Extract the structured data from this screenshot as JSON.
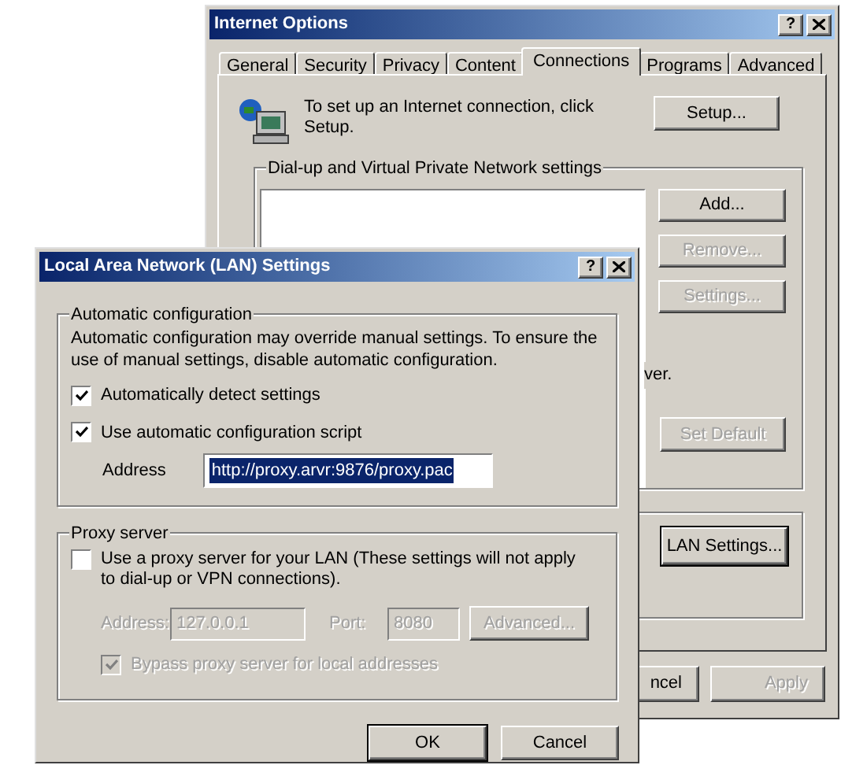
{
  "internet_options": {
    "title": "Internet Options",
    "help": "?",
    "tabs": [
      {
        "label": "General",
        "selected": false
      },
      {
        "label": "Security",
        "selected": false
      },
      {
        "label": "Privacy",
        "selected": false
      },
      {
        "label": "Content",
        "selected": false
      },
      {
        "label": "Connections",
        "selected": true
      },
      {
        "label": "Programs",
        "selected": false
      },
      {
        "label": "Advanced",
        "selected": false
      }
    ],
    "setup_text": "To set up an Internet connection, click Setup.",
    "setup_button": "Setup...",
    "dialup_group": "Dial-up and Virtual Private Network settings",
    "dialup_buttons": [
      {
        "label": "Add...",
        "disabled": false
      },
      {
        "label": "Remove...",
        "disabled": true
      },
      {
        "label": "Settings...",
        "disabled": true
      }
    ],
    "cut_text": "ver.",
    "set_default": {
      "label": "Set Default",
      "disabled": true
    },
    "lan_button": "LAN Settings...",
    "footer_buttons": [
      {
        "label": "ncel",
        "disabled": false
      },
      {
        "label": "Apply",
        "disabled": true
      }
    ]
  },
  "lan_dialog": {
    "title": "Local Area Network (LAN) Settings",
    "help": "?",
    "auto_group": "Automatic configuration",
    "auto_description": "Automatic configuration may override manual settings.  To ensure the use of manual settings, disable automatic configuration.",
    "auto_options": [
      {
        "label": "Automatically detect settings",
        "checked": true
      },
      {
        "label": "Use automatic configuration script",
        "checked": true
      }
    ],
    "script_address": {
      "label": "Address",
      "value": "http://proxy.arvr:9876/proxy.pac",
      "selected": true
    },
    "proxy_group": "Proxy server",
    "use_proxy": {
      "label": "Use a proxy server for your LAN (These settings will not apply to dial-up or VPN connections).",
      "checked": false
    },
    "proxy_address": {
      "label": "Address:",
      "value": "127.0.0.1",
      "disabled": true
    },
    "proxy_port": {
      "label": "Port:",
      "value": "8080",
      "disabled": true
    },
    "advanced_button": {
      "label": "Advanced...",
      "disabled": true
    },
    "bypass": {
      "label": "Bypass proxy server for local addresses",
      "checked": true,
      "disabled": true
    },
    "buttons": [
      "OK",
      "Cancel"
    ]
  }
}
